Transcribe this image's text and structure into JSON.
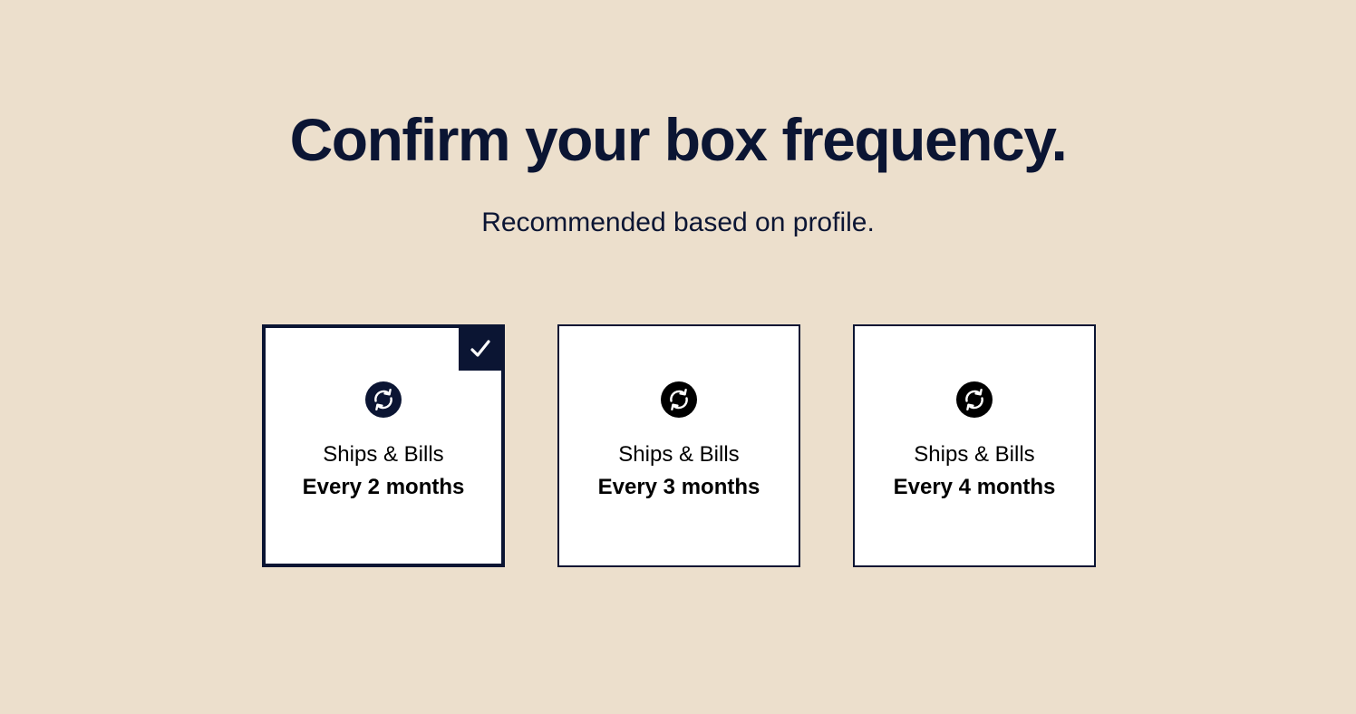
{
  "page": {
    "title": "Confirm your box frequency.",
    "subtitle": "Recommended based on profile."
  },
  "options": [
    {
      "line1": "Ships & Bills",
      "line2": "Every 2 months",
      "selected": true,
      "icon": "recurring-arrows-icon"
    },
    {
      "line1": "Ships & Bills",
      "line2": "Every 3 months",
      "selected": false,
      "icon": "recurring-arrows-icon"
    },
    {
      "line1": "Ships & Bills",
      "line2": "Every 4 months",
      "selected": false,
      "icon": "recurring-arrows-icon"
    }
  ],
  "colors": {
    "background": "#ecdfcc",
    "navy": "#0b1533",
    "card": "#ffffff",
    "icon_selected": "#0b1533",
    "icon_default": "#000000"
  }
}
